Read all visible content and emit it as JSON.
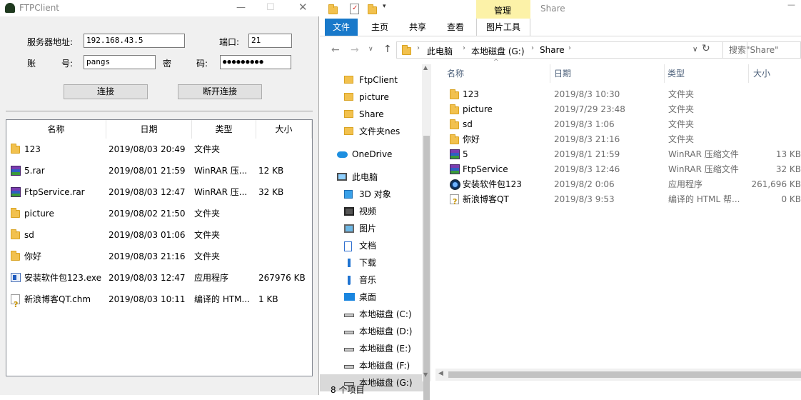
{
  "ftp": {
    "title": "FTPClient",
    "server_label": "服务器地址:",
    "server_value": "192.168.43.5",
    "port_label": "端口:",
    "port_value": "21",
    "account_label_1": "账",
    "account_label_2": "号:",
    "account_value": "pangs",
    "password_label_1": "密",
    "password_label_2": "码:",
    "password_value": "●●●●●●●●●",
    "connect_label": "连接",
    "disconnect_label": "断开连接",
    "columns": [
      "名称",
      "日期",
      "类型",
      "大小"
    ],
    "rows": [
      {
        "icon": "folder",
        "name": "123",
        "date": "2019/08/03 20:49",
        "type": "文件夹",
        "size": ""
      },
      {
        "icon": "rar",
        "name": "5.rar",
        "date": "2019/08/01 21:59",
        "type": "WinRAR 压...",
        "size": "12 KB"
      },
      {
        "icon": "rar",
        "name": "FtpService.rar",
        "date": "2019/08/03 12:47",
        "type": "WinRAR 压...",
        "size": "32 KB"
      },
      {
        "icon": "folder",
        "name": "picture",
        "date": "2019/08/02 21:50",
        "type": "文件夹",
        "size": ""
      },
      {
        "icon": "folder",
        "name": "sd",
        "date": "2019/08/03 01:06",
        "type": "文件夹",
        "size": ""
      },
      {
        "icon": "folder",
        "name": "你好",
        "date": "2019/08/03 21:16",
        "type": "文件夹",
        "size": ""
      },
      {
        "icon": "exe",
        "name": "安装软件包123.exe",
        "date": "2019/08/03 12:47",
        "type": "应用程序",
        "size": "267976 KB"
      },
      {
        "icon": "chm",
        "name": "新浪博客QT.chm",
        "date": "2019/08/03 10:11",
        "type": "编译的 HTM...",
        "size": "1 KB"
      }
    ]
  },
  "explorer": {
    "title": "Share",
    "manage_tab": "管理",
    "ribbon_tabs": [
      "文件",
      "主页",
      "共享",
      "查看",
      "图片工具"
    ],
    "breadcrumb": [
      "此电脑",
      "本地磁盘 (G:)",
      "Share"
    ],
    "search_placeholder": "搜索\"Share\"",
    "nav_items": [
      {
        "icon": "folder",
        "label": "FtpClient"
      },
      {
        "icon": "folder",
        "label": "picture"
      },
      {
        "icon": "folder",
        "label": "Share"
      },
      {
        "icon": "folder",
        "label": "文件夹nes"
      },
      {
        "icon": "cloud",
        "label": "OneDrive"
      },
      {
        "icon": "computer",
        "label": "此电脑"
      },
      {
        "icon": "cube",
        "label": "3D 对象"
      },
      {
        "icon": "video",
        "label": "视频"
      },
      {
        "icon": "picture",
        "label": "图片"
      },
      {
        "icon": "document",
        "label": "文档"
      },
      {
        "icon": "download",
        "label": "下载"
      },
      {
        "icon": "music",
        "label": "音乐"
      },
      {
        "icon": "desktop",
        "label": "桌面"
      },
      {
        "icon": "drive",
        "label": "本地磁盘 (C:)"
      },
      {
        "icon": "drive",
        "label": "本地磁盘 (D:)"
      },
      {
        "icon": "drive",
        "label": "本地磁盘 (E:)"
      },
      {
        "icon": "drive",
        "label": "本地磁盘 (F:)"
      },
      {
        "icon": "drive",
        "label": "本地磁盘 (G:)"
      }
    ],
    "columns": [
      "名称",
      "日期",
      "类型",
      "大小"
    ],
    "files": [
      {
        "icon": "folder",
        "name": "123",
        "date": "2019/8/3 10:30",
        "type": "文件夹",
        "size": ""
      },
      {
        "icon": "folder",
        "name": "picture",
        "date": "2019/7/29 23:48",
        "type": "文件夹",
        "size": ""
      },
      {
        "icon": "folder",
        "name": "sd",
        "date": "2019/8/3 1:06",
        "type": "文件夹",
        "size": ""
      },
      {
        "icon": "folder",
        "name": "你好",
        "date": "2019/8/3 21:16",
        "type": "文件夹",
        "size": ""
      },
      {
        "icon": "rar",
        "name": "5",
        "date": "2019/8/1 21:59",
        "type": "WinRAR 压缩文件",
        "size": "13 KB"
      },
      {
        "icon": "rar",
        "name": "FtpService",
        "date": "2019/8/3 12:46",
        "type": "WinRAR 压缩文件",
        "size": "32 KB"
      },
      {
        "icon": "exe2",
        "name": "安装软件包123",
        "date": "2019/8/2 0:06",
        "type": "应用程序",
        "size": "261,696 KB"
      },
      {
        "icon": "chm",
        "name": "新浪博客QT",
        "date": "2019/8/3 9:53",
        "type": "编译的 HTML 帮...",
        "size": "0 KB"
      }
    ],
    "status": "8 个项目",
    "colors": {
      "file_tab": "#1979ca",
      "manage_tab": "#fcf2a8",
      "selection": "#cce8ff"
    }
  }
}
